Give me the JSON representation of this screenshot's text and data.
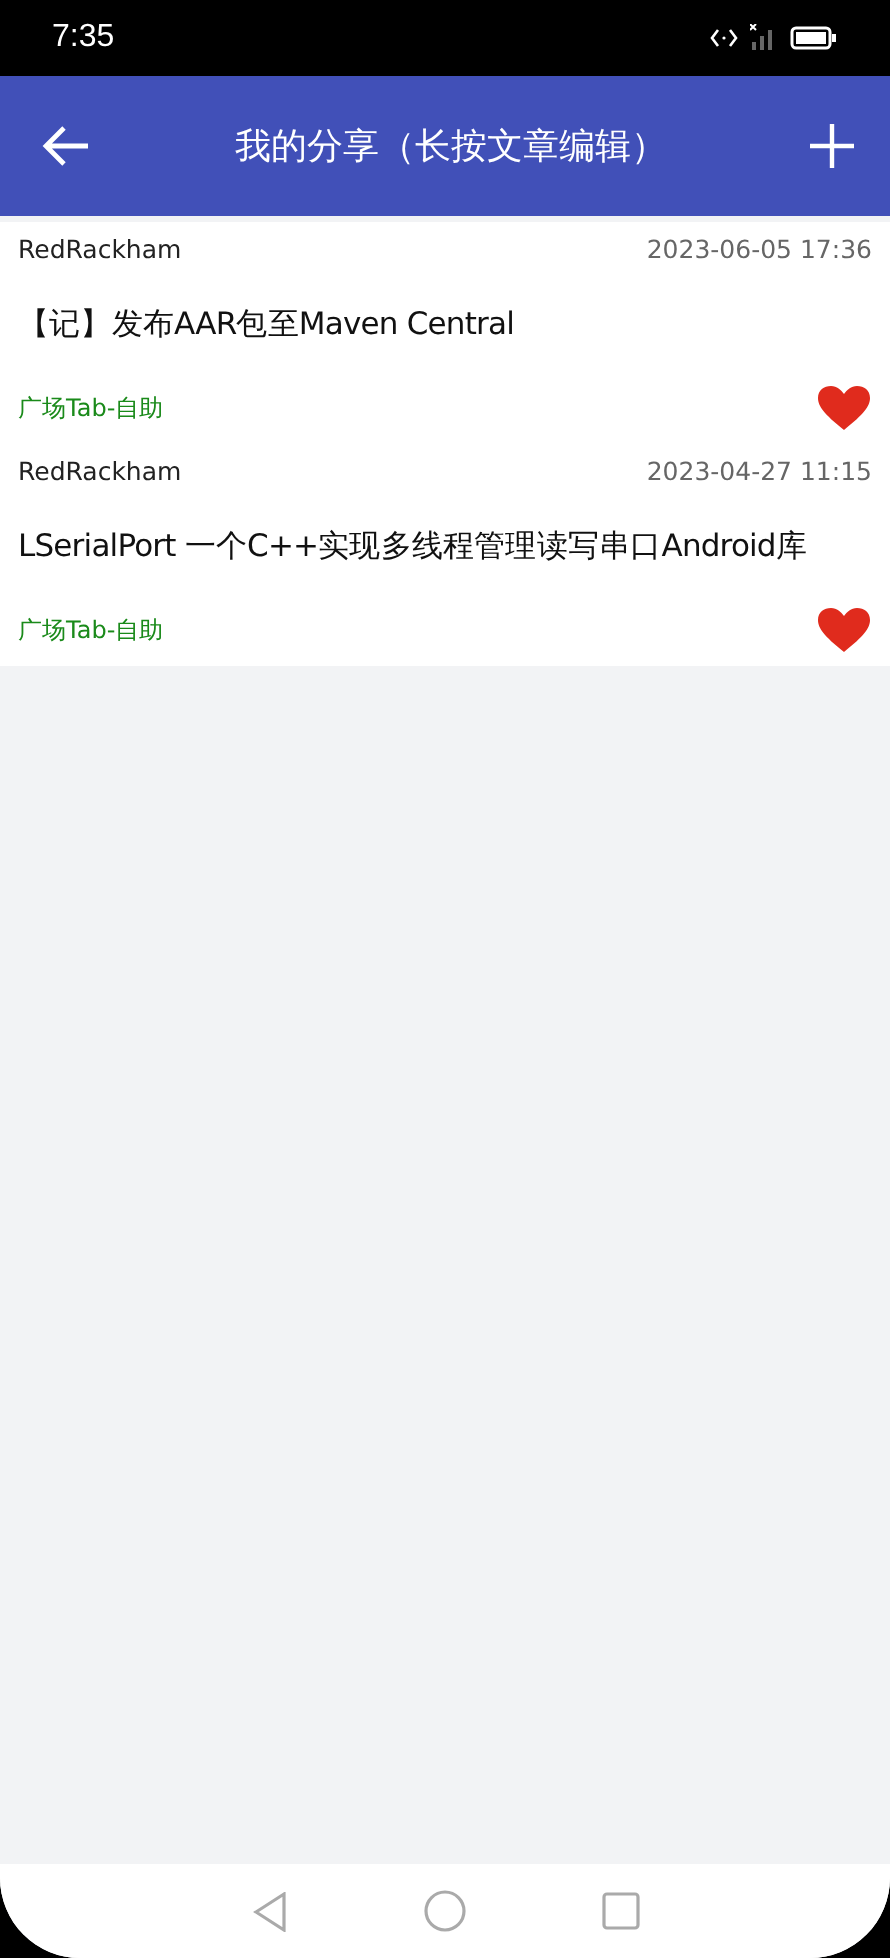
{
  "status_bar": {
    "time": "7:35"
  },
  "app_bar": {
    "title": "我的分享（长按文章编辑）"
  },
  "articles": [
    {
      "author": "RedRackham",
      "date": "2023-06-05 17:36",
      "title": "【记】发布AAR包至Maven Central",
      "category": "广场Tab-自助",
      "liked": true
    },
    {
      "author": "RedRackham",
      "date": "2023-04-27 11:15",
      "title": "LSerialPort 一个C++实现多线程管理读写串口Android库",
      "category": "广场Tab-自助",
      "liked": true
    }
  ]
}
